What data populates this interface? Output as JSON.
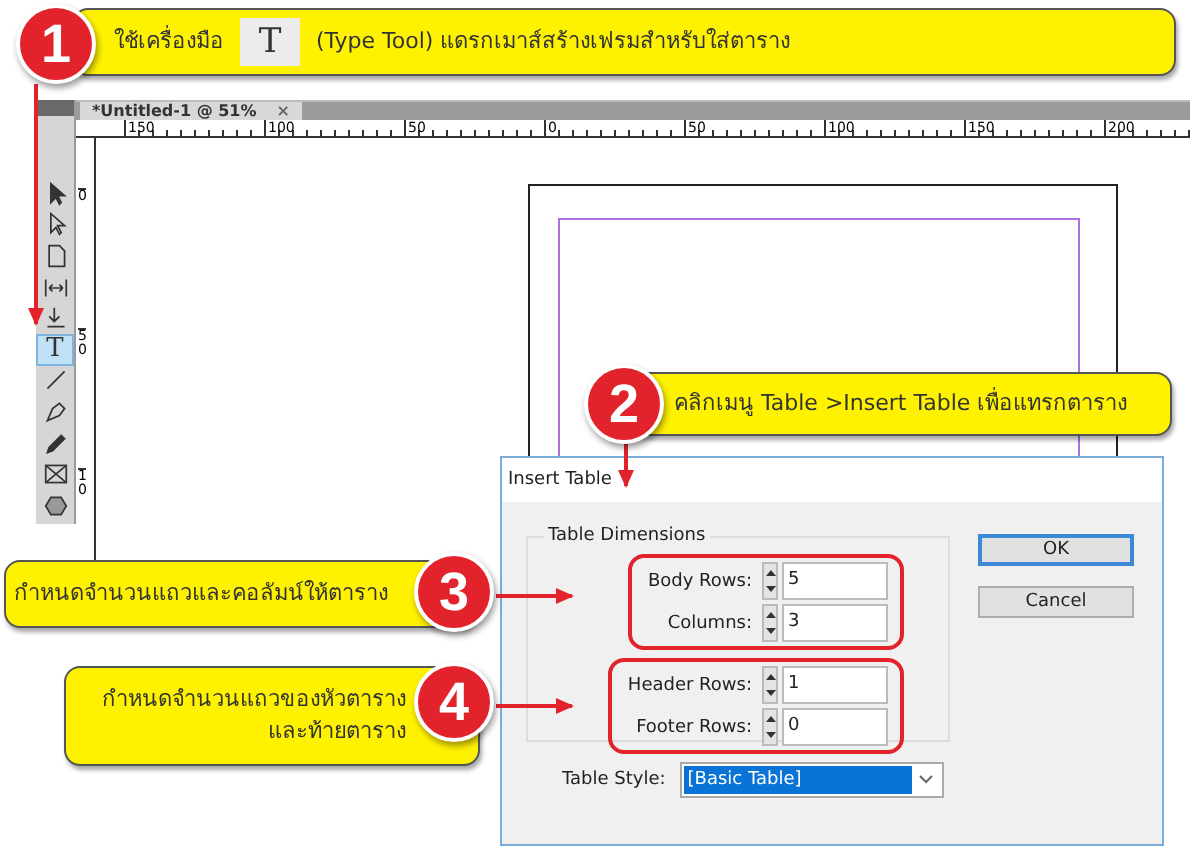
{
  "steps": [
    {
      "number": "1",
      "text_before": "ใช้เครื่องมือ",
      "tool_glyph": "T",
      "text_after": "(Type Tool) แดรกเมาส์สร้างเฟรมสำหรับใส่ตาราง"
    },
    {
      "number": "2",
      "text": "คลิกเมนู Table >Insert Table เพื่อแทรกตาราง"
    },
    {
      "number": "3",
      "text": "กำหนดจำนวนแถวและคอลัมน์ให้ตาราง"
    },
    {
      "number": "4",
      "text": "กำหนดจำนวนแถวของหัวตาราง\nและท้ายตาราง"
    }
  ],
  "document_tab": {
    "title": "*Untitled-1 @ 51%",
    "close": "×"
  },
  "top_ruler": [
    "150",
    "100",
    "50",
    "0",
    "50",
    "100",
    "150",
    "200"
  ],
  "side_ruler": [
    "0",
    "50",
    "10"
  ],
  "tools": [
    {
      "kind": "selection",
      "selected": false
    },
    {
      "kind": "direct-selection",
      "selected": false
    },
    {
      "kind": "page",
      "selected": false
    },
    {
      "kind": "gap",
      "selected": false
    },
    {
      "kind": "collector",
      "selected": false
    },
    {
      "kind": "type",
      "glyph": "T",
      "selected": true
    },
    {
      "kind": "line",
      "selected": false
    },
    {
      "kind": "pen",
      "selected": false
    },
    {
      "kind": "pencil",
      "selected": false
    },
    {
      "kind": "frame",
      "selected": false
    },
    {
      "kind": "polygon",
      "selected": false
    }
  ],
  "dialog": {
    "title": "Insert Table",
    "group_title": "Table Dimensions",
    "field_groups": [
      [
        {
          "label": "Body Rows:",
          "value": "5"
        },
        {
          "label": "Columns:",
          "value": "3"
        }
      ],
      [
        {
          "label": "Header Rows:",
          "value": "1"
        },
        {
          "label": "Footer Rows:",
          "value": "0"
        }
      ]
    ],
    "buttons": [
      {
        "label": "OK",
        "default": true
      },
      {
        "label": "Cancel",
        "default": false
      }
    ],
    "style_label": "Table Style:",
    "style_value": "[Basic Table]"
  }
}
